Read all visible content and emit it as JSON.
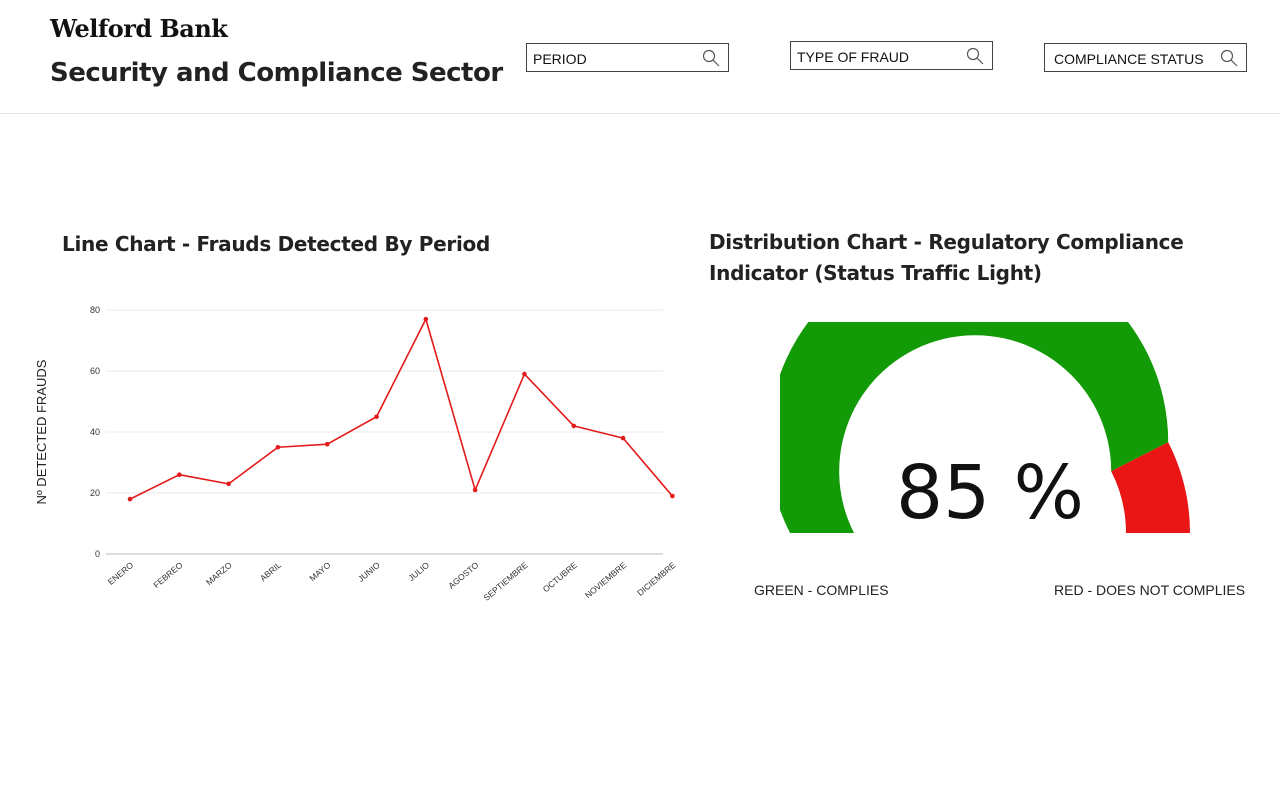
{
  "header": {
    "brand": "Welford Bank",
    "sector_title": "Security and Compliance Sector"
  },
  "filters": {
    "period": {
      "label": "PERIOD",
      "icon": "search-icon"
    },
    "fraud_type": {
      "label": "TYPE OF FRAUD",
      "icon": "search-icon"
    },
    "compliance_status": {
      "label": "COMPLIANCE STATUS",
      "icon": "search-icon"
    }
  },
  "line_chart": {
    "title": "Line Chart - Frauds Detected By Period"
  },
  "distribution_chart": {
    "title": "Distribution Chart - Regulatory Compliance Indicator (Status Traffic Light)",
    "value_text": "85 %",
    "legend_green": "GREEN - COMPLIES",
    "legend_red": "RED - DOES NOT COMPLIES"
  },
  "colors": {
    "line": "#e31a1a",
    "green": "#129b06",
    "red": "#ea1515",
    "grid": "#e8e8e8"
  },
  "chart_data": [
    {
      "type": "line",
      "title": "Line Chart - Frauds Detected By Period",
      "xlabel": "",
      "ylabel": "Nº DETECTED FRAUDS",
      "categories": [
        "ENERO",
        "FEBREO",
        "MARZO",
        "ABRIL",
        "MAYO",
        "JUNIO",
        "JULIO",
        "AGOSTO",
        "SEPTIEMBRE",
        "OCTUBRE",
        "NOVIEMBRE",
        "DICIEMBRE"
      ],
      "values": [
        18,
        26,
        23,
        35,
        36,
        45,
        77,
        21,
        59,
        42,
        38,
        19
      ],
      "yticks": [
        "0",
        "20",
        "40",
        "60",
        "80"
      ],
      "ylim": [
        0,
        80
      ],
      "grid": true
    },
    {
      "type": "pie",
      "title": "Distribution Chart - Regulatory Compliance Indicator (Status Traffic Light)",
      "categories": [
        "GREEN - COMPLIES",
        "RED - DOES NOT COMPLIES"
      ],
      "values": [
        85,
        15
      ],
      "center_label": "85 %"
    }
  ]
}
